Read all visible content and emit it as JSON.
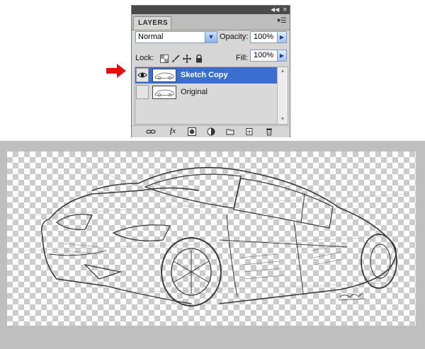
{
  "panel": {
    "tab_label": "LAYERS",
    "blend_mode": "Normal",
    "opacity_label": "Opacity:",
    "opacity_value": "100%",
    "lock_label": "Lock:",
    "fill_label": "Fill:",
    "fill_value": "100%",
    "layers": [
      {
        "name": "Sketch Copy",
        "visible": true,
        "selected": true
      },
      {
        "name": "Original",
        "visible": false,
        "selected": false
      }
    ]
  },
  "icons": {
    "collapse": "double-chevron-left-icon",
    "close": "close-icon",
    "panel_menu": "panel-menu-icon",
    "dropdown": "chevron-down-icon",
    "arrow": "arrow-right-icon",
    "eye": "eye-icon",
    "link": "link-icon",
    "fx": "fx-icon",
    "mask": "mask-icon",
    "adjustment": "adjustment-icon",
    "folder": "folder-icon",
    "new_layer": "new-layer-icon",
    "trash": "trash-icon",
    "annotation_arrow": "red-arrow-icon"
  },
  "bottom_bar": {
    "fx_label": "fx"
  },
  "colors": {
    "selection": "#3a6fcf",
    "annotation": "#e41010",
    "panel_bg": "#d6d6d6"
  }
}
